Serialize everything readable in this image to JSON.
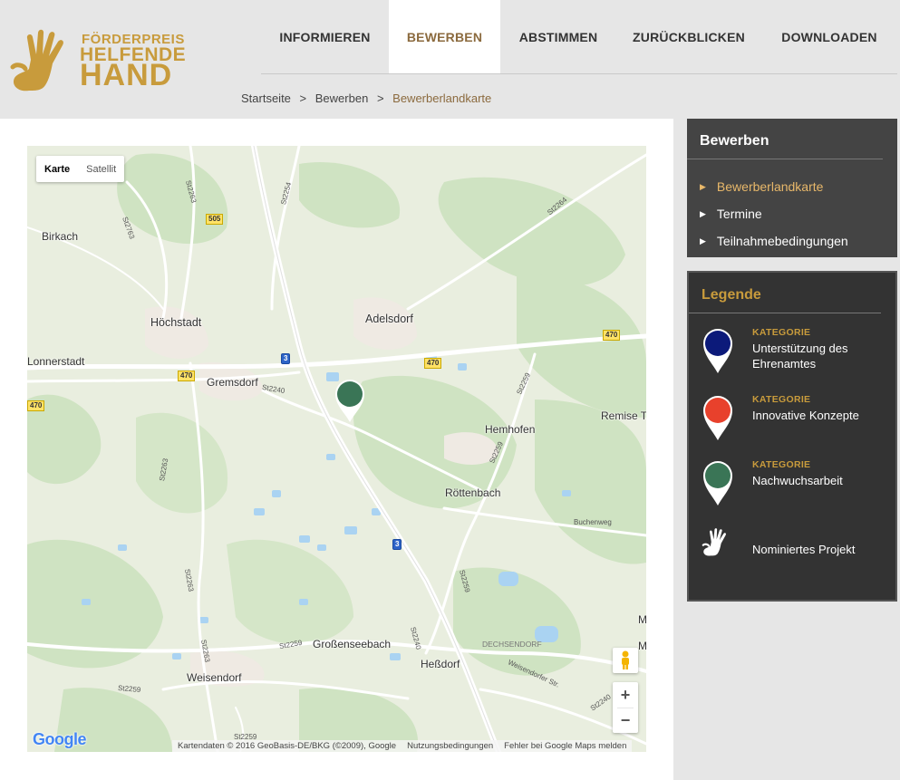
{
  "logo": {
    "line1": "FÖRDERPREIS",
    "line2": "HELFENDE",
    "line3": "HAND"
  },
  "nav": {
    "items": [
      {
        "label": "INFORMIEREN",
        "active": false
      },
      {
        "label": "BEWERBEN",
        "active": true
      },
      {
        "label": "ABSTIMMEN",
        "active": false
      },
      {
        "label": "ZURÜCKBLICKEN",
        "active": false
      },
      {
        "label": "DOWNLOADEN",
        "active": false
      }
    ]
  },
  "breadcrumb": {
    "home": "Startseite",
    "parent": "Bewerben",
    "current": "Bewerberlandkarte",
    "separator": ">"
  },
  "map": {
    "type_map": "Karte",
    "type_satellite": "Satellit",
    "places": {
      "birkach": "Birkach",
      "hoechstadt": "Höchstadt",
      "adelsdorf": "Adelsdorf",
      "lonnerstadt": "Lonnerstadt",
      "gremsdorf": "Gremsdorf",
      "hemhofen": "Hemhofen",
      "remise": "Remise T",
      "roettenbach": "Röttenbach",
      "buchenweg": "Buchenweg",
      "grossenseebach": "Großenseebach",
      "hessdorf": "Heßdorf",
      "dechsendorf": "DECHSENDORF",
      "weisendorf": "Weisendorf",
      "weisendorfer": "Weisendorfer Str."
    },
    "roads": {
      "st2263a": "St2263",
      "st2254": "St2254",
      "st2763": "St2763",
      "st2264": "St2264",
      "st2240a": "St2240",
      "st2259a": "St2259",
      "st2259b": "St2259",
      "st2263b": "St2263",
      "st2263c": "St2263",
      "st2259c": "St2259",
      "st2263d": "St2263",
      "st2259d": "St2259",
      "st2240b": "St2240",
      "st2259e": "St2259",
      "st2240c": "St2240",
      "st2259f": "St2259"
    },
    "shields": {
      "b505": "505",
      "b470a": "470",
      "b470b": "470",
      "b470c": "470",
      "b470d": "470",
      "a3a": "3",
      "a3b": "3"
    },
    "zoom_in": "+",
    "zoom_out": "−",
    "google": "Google",
    "attribution": "Kartendaten © 2016 GeoBasis-DE/BKG (©2009), Google",
    "terms": "Nutzungsbedingungen",
    "report": "Fehler bei Google Maps melden",
    "edge_m1": "M",
    "edge_m2": "M"
  },
  "sidebar": {
    "title": "Bewerben",
    "items": [
      {
        "label": "Bewerberlandkarte",
        "active": true
      },
      {
        "label": "Termine",
        "active": false
      },
      {
        "label": "Teilnahmebedingungen",
        "active": false
      }
    ]
  },
  "legend": {
    "title": "Legende",
    "items": [
      {
        "kat": "KATEGORIE",
        "name": "Unterstützung des Ehrenamtes",
        "color": "#0c1a7a"
      },
      {
        "kat": "KATEGORIE",
        "name": "Innovative Konzepte",
        "color": "#e8412c"
      },
      {
        "kat": "KATEGORIE",
        "name": "Nachwuchsarbeit",
        "color": "#3a7556"
      }
    ],
    "nominated": "Nominiertes Projekt"
  },
  "colors": {
    "accent": "#c89b3c",
    "nav_active": "#8b6a3e",
    "marker_green": "#3a7556"
  }
}
